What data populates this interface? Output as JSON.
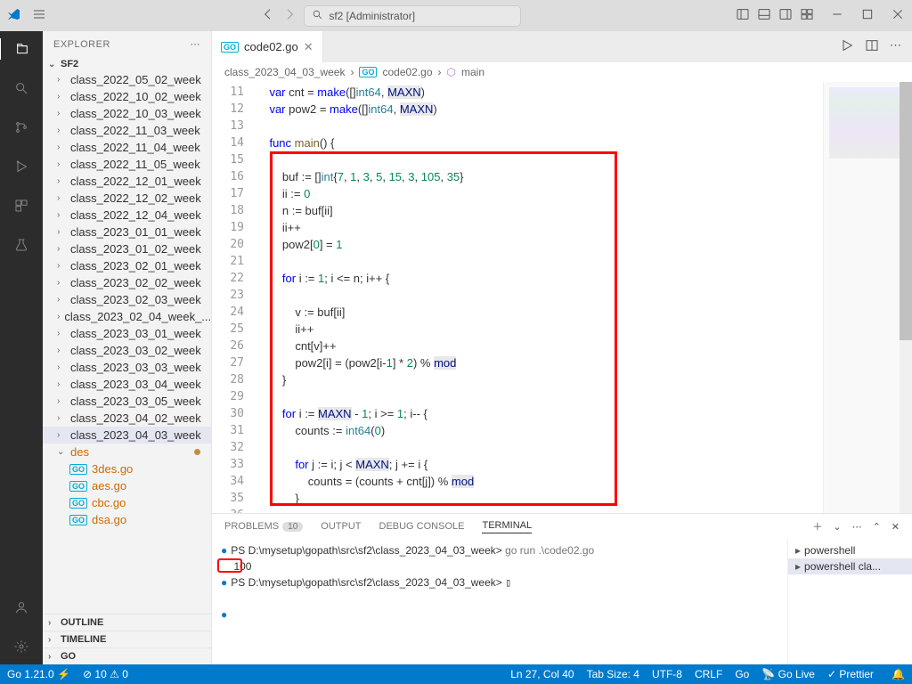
{
  "titlebar": {
    "search": "sf2 [Administrator]"
  },
  "sidebar": {
    "title": "EXPLORER",
    "project": "SF2",
    "folders": [
      "class_2022_05_02_week",
      "class_2022_10_02_week",
      "class_2022_10_03_week",
      "class_2022_11_03_week",
      "class_2022_11_04_week",
      "class_2022_11_05_week",
      "class_2022_12_01_week",
      "class_2022_12_02_week",
      "class_2022_12_04_week",
      "class_2023_01_01_week",
      "class_2023_01_02_week",
      "class_2023_02_01_week",
      "class_2023_02_02_week",
      "class_2023_02_03_week",
      "class_2023_02_04_week_...",
      "class_2023_03_01_week",
      "class_2023_03_02_week",
      "class_2023_03_03_week",
      "class_2023_03_04_week",
      "class_2023_03_05_week",
      "class_2023_04_02_week",
      "class_2023_04_03_week"
    ],
    "des_folder": "des",
    "files": [
      "3des.go",
      "aes.go",
      "cbc.go",
      "dsa.go"
    ],
    "panels": [
      "OUTLINE",
      "TIMELINE",
      "GO"
    ]
  },
  "tab": {
    "name": "code02.go"
  },
  "breadcrumb": {
    "a": "class_2023_04_03_week",
    "b": "code02.go",
    "c": "main"
  },
  "code": {
    "l11": "    var cnt = make([]int64, MAXN)",
    "l12": "    var pow2 = make([]int64, MAXN)",
    "l13": "",
    "l14": "    func main() {",
    "l15": "",
    "l16": "        buf := []int{7, 1, 3, 5, 15, 3, 105, 35}",
    "l17": "        ii := 0",
    "l18": "        n := buf[ii]",
    "l19": "        ii++",
    "l20": "        pow2[0] = 1",
    "l21": "",
    "l22": "        for i := 1; i <= n; i++ {",
    "l23": "",
    "l24": "            v := buf[ii]",
    "l25": "            ii++",
    "l26": "            cnt[v]++",
    "l27": "            pow2[i] = (pow2[i-1] * 2) % mod",
    "l28": "        }",
    "l29": "",
    "l30": "        for i := MAXN - 1; i >= 1; i-- {",
    "l31": "            counts := int64(0)",
    "l32": "",
    "l33": "            for j := i; j < MAXN; j += i {",
    "l34": "                counts = (counts + cnt[j]) % mod",
    "l35": "            }",
    "l36": ""
  },
  "panel": {
    "tabs": {
      "problems": "PROBLEMS",
      "problems_count": "10",
      "output": "OUTPUT",
      "debug": "DEBUG CONSOLE",
      "terminal": "TERMINAL"
    },
    "prompt1": "PS D:\\mysetup\\gopath\\src\\sf2\\class_2023_04_03_week> ",
    "cmd1": "go run .\\code02.go",
    "out": "100",
    "prompt2": "PS D:\\mysetup\\gopath\\src\\sf2\\class_2023_04_03_week> ",
    "terms": [
      "powershell",
      "powershell  cla..."
    ]
  },
  "status": {
    "go": "Go 1.21.0",
    "errors": "10",
    "warnings": "0",
    "ln": "Ln 27, Col 40",
    "tab": "Tab Size: 4",
    "enc": "UTF-8",
    "eol": "CRLF",
    "lang": "Go",
    "live": "Go Live",
    "prettier": "Prettier"
  }
}
